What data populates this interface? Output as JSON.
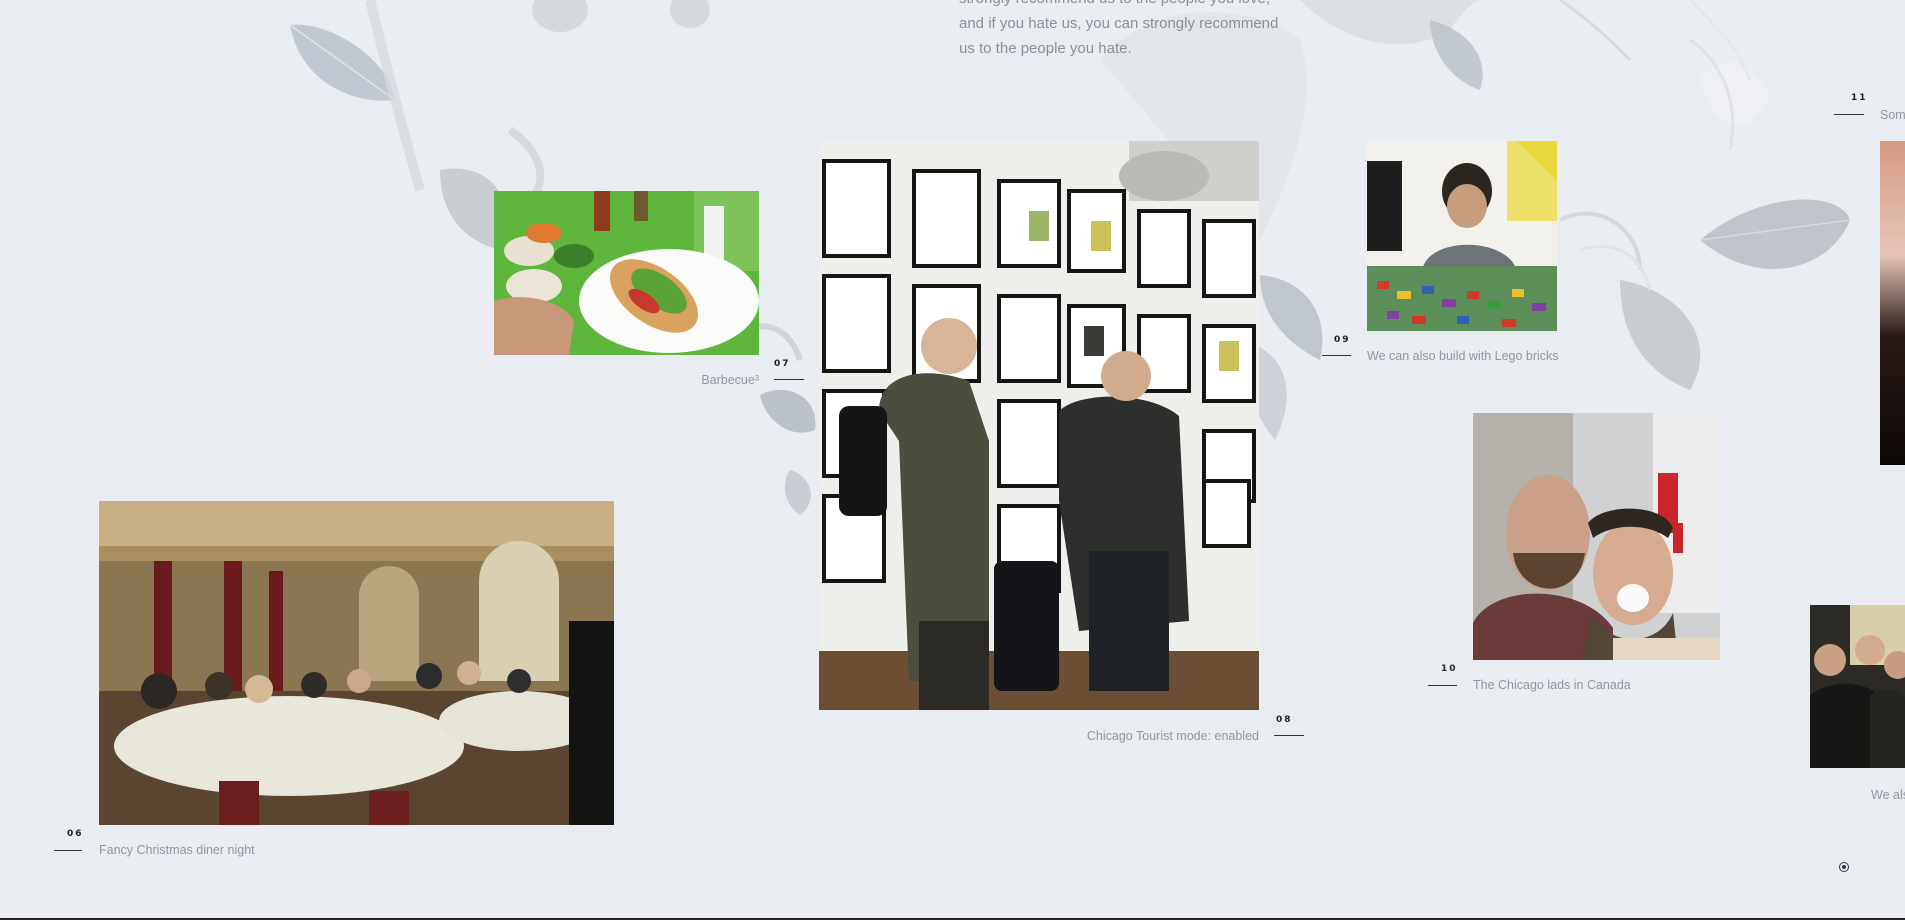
{
  "intro": {
    "line1": "strongly recommend us to the people you love,",
    "line2": "and if you hate us, you can strongly recommend",
    "line3": "us to the people you hate."
  },
  "gallery": [
    {
      "number": "06",
      "caption": "Fancy Christmas diner night"
    },
    {
      "number": "07",
      "caption": "Barbecue³"
    },
    {
      "number": "08",
      "caption": "Chicago Tourist mode: enabled"
    },
    {
      "number": "09",
      "caption": "We can also build with Lego bricks"
    },
    {
      "number": "10",
      "caption": "The Chicago lads in Canada"
    },
    {
      "number": "11",
      "caption": "Som"
    },
    {
      "number": "",
      "caption": "We als"
    }
  ],
  "colors": {
    "background": "#e9ecf0",
    "caption": "#9097a3",
    "rule": "#333333",
    "accent": "#2a3350"
  }
}
